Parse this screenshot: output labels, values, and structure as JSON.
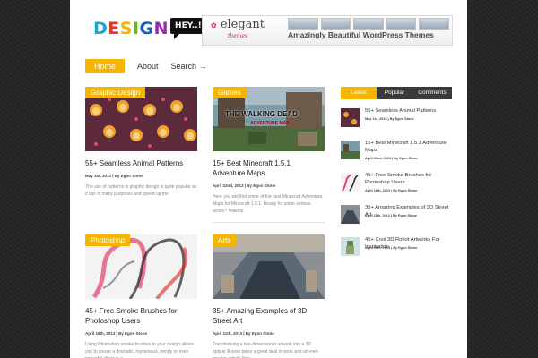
{
  "logo": {
    "letters": [
      {
        "ch": "D",
        "color": "#1aa3dd"
      },
      {
        "ch": "E",
        "color": "#e8332a"
      },
      {
        "ch": "S",
        "color": "#f4b400"
      },
      {
        "ch": "I",
        "color": "#6ab42d"
      },
      {
        "ch": "G",
        "color": "#1a5fb4"
      },
      {
        "ch": "N",
        "color": "#9c27b0"
      }
    ],
    "bubble": "HEY..!"
  },
  "banner": {
    "brand": "elegant",
    "brand_sub": "themes",
    "text": "Amazingly Beautiful WordPress Themes"
  },
  "nav": {
    "items": [
      "Home",
      "About",
      "Search →"
    ]
  },
  "colors": {
    "accent": "#f4b400",
    "dark_tab": "#3a3a3a"
  },
  "posts": [
    {
      "category": "Graphic Design",
      "title": "55+ Seamless Animal Patterns",
      "meta": "May 1st, 2013 | By Egon Stone",
      "excerpt": "The use of patterns in graphic design is quite popular as it can fit many purposes and speed up the"
    },
    {
      "category": "Games",
      "title": "15+ Best Minecraft 1.5.1 Adventure Maps",
      "meta": "April 22nd, 2013 | By Egon Stone",
      "excerpt": "Here you will find some of the best Minecraft Adventure Maps for Minecraft 1.5.1. Ready for some serious action? Millions",
      "thumb_text": "THE WALKING DEAD",
      "thumb_sub": "ADVENTURE MAP"
    },
    {
      "category": "Photoshop",
      "title": "45+ Free Smoke Brushes for Photoshop Users",
      "meta": "April 18th, 2013 | By Egon Stone",
      "excerpt": "Using Photoshop smoke brushes in your design allows you to create a dramatic, mysterious, trendy or even powerful effect in a"
    },
    {
      "category": "Arts",
      "title": "35+ Amazing Examples of 3D Street Art",
      "meta": "April 11th, 2013 | By Egon Stone",
      "excerpt": "Transforming a two-dimensional artwork into a 3D optical illusion takes a great deal of work and an ever-greater artistic flair."
    }
  ],
  "sidebar": {
    "tabs": [
      "Latest",
      "Popular",
      "Comments"
    ],
    "items": [
      {
        "title": "55+ Seamless Animal Patterns",
        "meta": "May 1st, 2013 | By Egon Stone"
      },
      {
        "title": "15+ Best Minecraft 1.5.1 Adventure Maps",
        "meta": "April 22nd, 2013 | By Egon Stone"
      },
      {
        "title": "45+ Free Smoke Brushes for Photoshop Users",
        "meta": "April 18th, 2013 | By Egon Stone"
      },
      {
        "title": "35+ Amazing Examples of 3D Street Art",
        "meta": "April 11th, 2013 | By Egon Stone"
      },
      {
        "title": "45+ Cool 3D Robot Artworks For Inspiration",
        "meta": "April 10th, 2013 | By Egon Stone"
      }
    ]
  }
}
